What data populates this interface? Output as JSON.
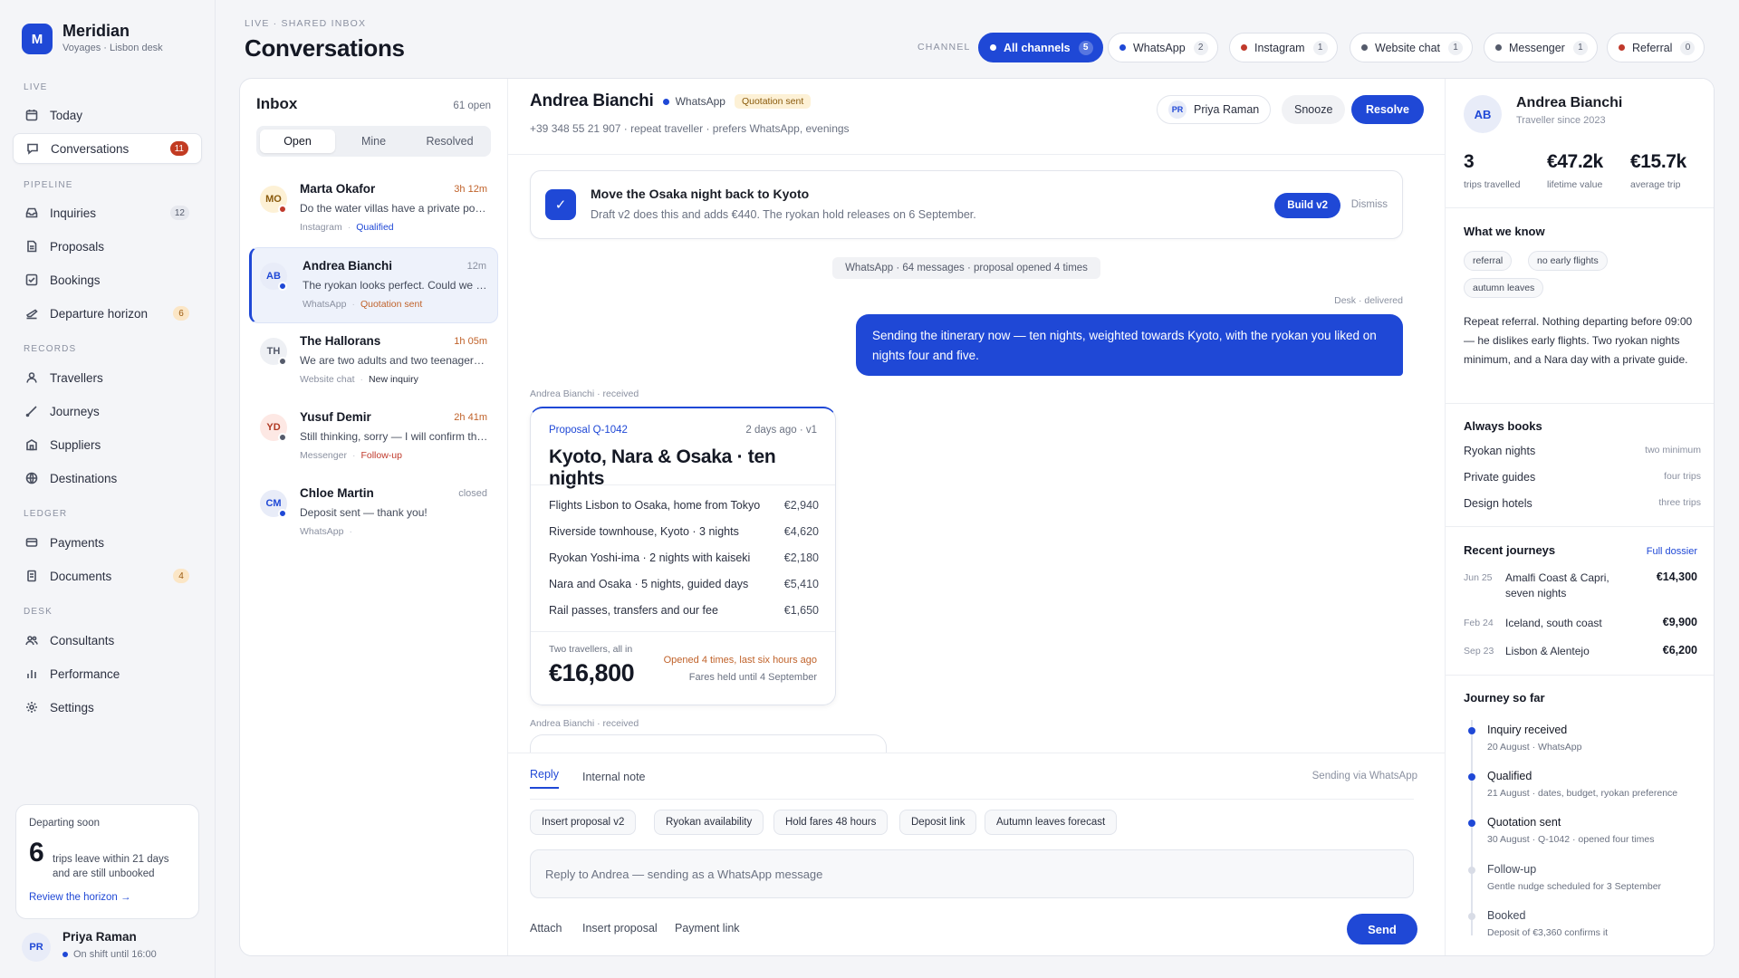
{
  "brand": {
    "name": "Meridian",
    "subtitle": "Voyages · Lisbon desk",
    "initial": "M"
  },
  "sidebar": {
    "sections": {
      "live": "LIVE",
      "pipeline": "PIPELINE",
      "records": "RECORDS",
      "ledger": "LEDGER",
      "desk": "DESK"
    },
    "items": [
      {
        "label": "Today",
        "icon": "calendar-icon"
      },
      {
        "label": "Conversations",
        "icon": "chat-icon",
        "badge": "11"
      },
      {
        "label": "Inquiries",
        "icon": "inbox-icon",
        "badge": "12"
      },
      {
        "label": "Proposals",
        "icon": "document-icon"
      },
      {
        "label": "Bookings",
        "icon": "check-square-icon"
      },
      {
        "label": "Departure horizon",
        "icon": "plane-icon",
        "badge": "6"
      },
      {
        "label": "Travellers",
        "icon": "person-icon"
      },
      {
        "label": "Journeys",
        "icon": "route-icon"
      },
      {
        "label": "Suppliers",
        "icon": "building-icon"
      },
      {
        "label": "Destinations",
        "icon": "globe-icon"
      },
      {
        "label": "Payments",
        "icon": "card-icon"
      },
      {
        "label": "Documents",
        "icon": "file-icon",
        "badge": "4"
      },
      {
        "label": "Consultants",
        "icon": "people-icon"
      },
      {
        "label": "Performance",
        "icon": "bar-chart-icon"
      },
      {
        "label": "Settings",
        "icon": "gear-icon"
      }
    ],
    "departing": {
      "label": "Departing soon",
      "count": "6",
      "text": "trips leave within 21 days and are still unbooked",
      "link": "Review the horizon →"
    },
    "user": {
      "initials": "PR",
      "name": "Priya Raman",
      "status": "On shift until 16:00"
    }
  },
  "header": {
    "kicker": "LIVE · SHARED INBOX",
    "title": "Conversations",
    "channel_label": "CHANNEL"
  },
  "channels": [
    {
      "label": "All channels",
      "count": "5",
      "color": "#ffffff"
    },
    {
      "label": "WhatsApp",
      "count": "2",
      "color": "#1f48d6"
    },
    {
      "label": "Instagram",
      "count": "1",
      "color": "#c0392b"
    },
    {
      "label": "Website chat",
      "count": "1",
      "color": "#555b6b"
    },
    {
      "label": "Messenger",
      "count": "1",
      "color": "#555b6b"
    },
    {
      "label": "Referral",
      "count": "0",
      "color": "#c0392b"
    }
  ],
  "inbox": {
    "title": "Inbox",
    "open_count": "61 open",
    "tabs": [
      "Open",
      "Mine",
      "Resolved"
    ],
    "conversations": [
      {
        "initials": "MO",
        "name": "Marta Okafor",
        "time": "3h 12m",
        "snippet": "Do the water villas have a private pool?",
        "channel": "Instagram",
        "status": "Qualified",
        "status_color": "#1f48d6",
        "time_color": "#c0622a",
        "av_bg": "#fdf1d6",
        "av_fg": "#8a5a0c",
        "dot": "#c0392b"
      },
      {
        "initials": "AB",
        "name": "Andrea Bianchi",
        "time": "12m",
        "snippet": "The ryokan looks perfect. Could we move one night?",
        "channel": "WhatsApp",
        "status": "Quotation sent",
        "status_color": "#c0622a",
        "time_color": "#8a90a0",
        "av_bg": "#e8ecf8",
        "av_fg": "#1f48d6",
        "dot": "#1f48d6"
      },
      {
        "initials": "TH",
        "name": "The Hallorans",
        "time": "1h 05m",
        "snippet": "We are two adults and two teenagers travelling",
        "channel": "Website chat",
        "status": "New inquiry",
        "status_color": "#2b3040",
        "time_color": "#c0622a",
        "av_bg": "#eef0f4",
        "av_fg": "#555b6b",
        "dot": "#555b6b"
      },
      {
        "initials": "YD",
        "name": "Yusuf Demir",
        "time": "2h 41m",
        "snippet": "Still thinking, sorry — I will confirm this week",
        "channel": "Messenger",
        "status": "Follow-up",
        "status_color": "#c0392b",
        "time_color": "#c0622a",
        "av_bg": "#fde8e4",
        "av_fg": "#b03a24",
        "dot": "#555b6b"
      },
      {
        "initials": "CM",
        "name": "Chloe Martin",
        "time": "closed",
        "snippet": "Deposit sent — thank you!",
        "channel": "WhatsApp",
        "status": "",
        "status_color": "#8a90a0",
        "time_color": "#8a90a0",
        "av_bg": "#e8ecf8",
        "av_fg": "#1f48d6",
        "dot": "#1f48d6"
      }
    ]
  },
  "thread": {
    "name": "Andrea Bianchi",
    "channel": "WhatsApp",
    "badge": "Quotation sent",
    "sub": "+39 348 55 21 907 · repeat traveller · prefers WhatsApp, evenings",
    "assignee_initials": "PR",
    "assignee": "Priya Raman",
    "snooze": "Snooze",
    "resolve": "Resolve",
    "suggestion": {
      "title": "Move the Osaka night back to Kyoto",
      "text": "Draft v2 does this and adds €440. The ryokan hold releases on 6 September.",
      "build": "Build v2",
      "dismiss": "Dismiss"
    },
    "system_note": "WhatsApp · 64 messages · proposal opened 4 times",
    "outgoing_meta": "Desk · delivered",
    "outgoing": "Sending the itinerary now — ten nights, weighted towards Kyoto, with the ryokan you liked on nights four and five.",
    "received_meta": "Andrea Bianchi · received",
    "proposal": {
      "id": "Proposal Q-1042",
      "ago": "2 days ago · v1",
      "title": "Kyoto, Nara & Osaka · ten nights",
      "lines": [
        {
          "label": "Flights Lisbon to Osaka, home from Tokyo",
          "amount": "€2,940"
        },
        {
          "label": "Riverside townhouse, Kyoto · 3 nights",
          "amount": "€4,620"
        },
        {
          "label": "Ryokan Yoshi-ima · 2 nights with kaiseki",
          "amount": "€2,180"
        },
        {
          "label": "Nara and Osaka · 5 nights, guided days",
          "amount": "€5,410"
        },
        {
          "label": "Rail passes, transfers and our fee",
          "amount": "€1,650"
        }
      ],
      "total_label": "Two travellers, all in",
      "total": "€16,800",
      "opened": "Opened 4 times, last six hours ago",
      "held": "Fares held until 4 September"
    },
    "received_meta2": "Andrea Bianchi · received"
  },
  "composer": {
    "tab_reply": "Reply",
    "tab_note": "Internal note",
    "via": "Sending via WhatsApp",
    "quick": [
      "Insert proposal v2",
      "Ryokan availability",
      "Hold fares 48 hours",
      "Deposit link",
      "Autumn leaves forecast"
    ],
    "placeholder": "Reply to Andrea — sending as a WhatsApp message",
    "attach": "Attach",
    "insert": "Insert proposal",
    "payment": "Payment link",
    "send": "Send"
  },
  "profile": {
    "initials": "AB",
    "name": "Andrea Bianchi",
    "since": "Traveller since 2023",
    "stats": [
      {
        "value": "3",
        "label": "trips travelled"
      },
      {
        "value": "€47.2k",
        "label": "lifetime value"
      },
      {
        "value": "€15.7k",
        "label": "average trip"
      }
    ],
    "know_title": "What we know",
    "tags": [
      "referral",
      "no early flights",
      "autumn leaves"
    ],
    "note": "Repeat referral. Nothing departing before 09:00 — he dislikes early flights. Two ryokan nights minimum, and a Nara day with a private guide.",
    "always_title": "Always books",
    "always": [
      {
        "label": "Ryokan nights",
        "note": "two minimum"
      },
      {
        "label": "Private guides",
        "note": "four trips"
      },
      {
        "label": "Design hotels",
        "note": "three trips"
      }
    ],
    "recent_title": "Recent journeys",
    "recent_link": "Full dossier",
    "recent": [
      {
        "date": "Jun 25",
        "name": "Amalfi Coast & Capri, seven nights",
        "amount": "€14,300"
      },
      {
        "date": "Feb 24",
        "name": "Iceland, south coast",
        "amount": "€9,900"
      },
      {
        "date": "Sep 23",
        "name": "Lisbon & Alentejo",
        "amount": "€6,200"
      }
    ],
    "journey_title": "Journey so far",
    "timeline": [
      {
        "title": "Inquiry received",
        "sub": "20 August · WhatsApp",
        "done": true
      },
      {
        "title": "Qualified",
        "sub": "21 August · dates, budget, ryokan preference",
        "done": true
      },
      {
        "title": "Quotation sent",
        "sub": "30 August · Q-1042 · opened four times",
        "done": true
      },
      {
        "title": "Follow-up",
        "sub": "Gentle nudge scheduled for 3 September",
        "done": false
      },
      {
        "title": "Booked",
        "sub": "Deposit of €3,360 confirms it",
        "done": false
      }
    ]
  }
}
